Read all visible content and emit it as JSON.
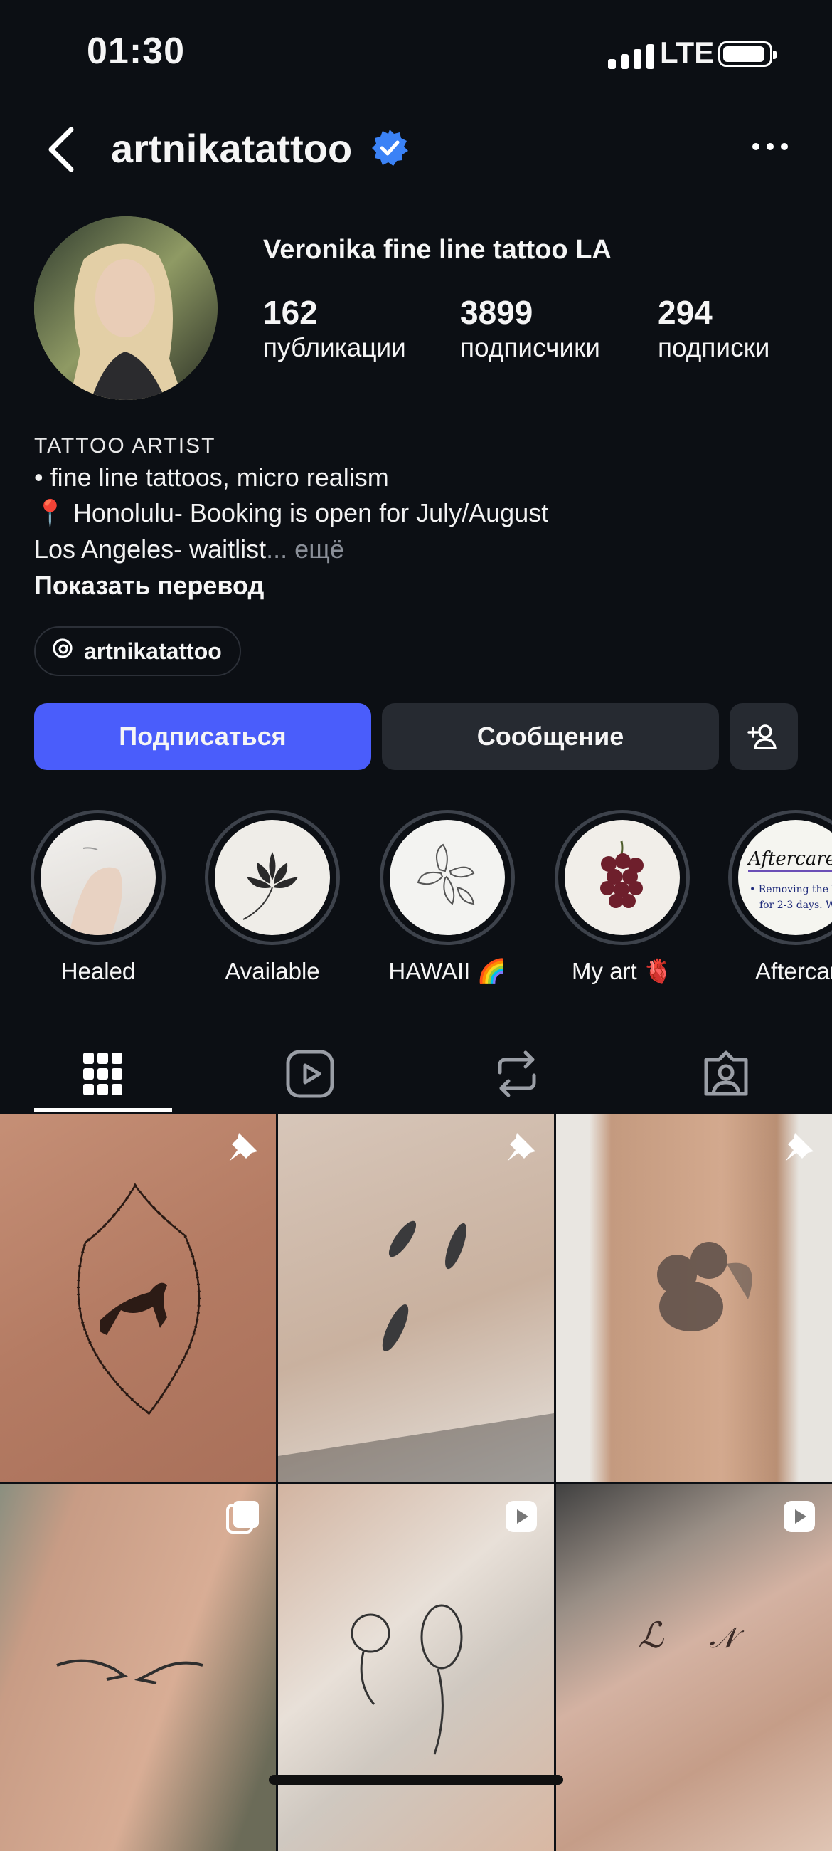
{
  "status_bar": {
    "time": "01:30",
    "network": "LTE",
    "signal_bars": 4
  },
  "header": {
    "username": "artnikatattoo",
    "verified": true
  },
  "profile": {
    "display_name": "Veronika fine line tattoo LA",
    "stats": [
      {
        "value": "162",
        "label": "публикации"
      },
      {
        "value": "3899",
        "label": "подписчики"
      },
      {
        "value": "294",
        "label": "подписки"
      }
    ],
    "category": "TATTOO ARTIST",
    "bio_lines": [
      "• fine line tattoos, micro realism",
      "📍 Honolulu- Booking is open for July/August",
      "Los Angeles- waitlist"
    ],
    "more_text": "... ещё",
    "translate_label": "Показать перевод",
    "threads_handle": "artnikatattoo"
  },
  "actions": {
    "follow": "Подписаться",
    "message": "Сообщение"
  },
  "highlights": [
    {
      "label": "Healed"
    },
    {
      "label": "Available"
    },
    {
      "label": "HAWAII 🌈"
    },
    {
      "label": "My art 🫀"
    },
    {
      "label": "Aftercare"
    }
  ],
  "aftercare_thumb": {
    "title": "Aftercare",
    "line1": "• Removing the Wrap",
    "line2": "for 2-3 days. W"
  },
  "tabs": [
    "grid-icon",
    "reels-icon",
    "reposts-icon",
    "tagged-icon"
  ],
  "grid_posts": [
    {
      "badge": "pin-icon"
    },
    {
      "badge": "pin-icon"
    },
    {
      "badge": "pin-icon"
    },
    {
      "badge": "carousel-icon"
    },
    {
      "badge": "reel-icon"
    },
    {
      "badge": "reel-icon"
    }
  ],
  "colors": {
    "background": "#0c0f14",
    "follow_button": "#4a5dfb",
    "secondary_button": "#262a31",
    "verified": "#3b82f6"
  }
}
